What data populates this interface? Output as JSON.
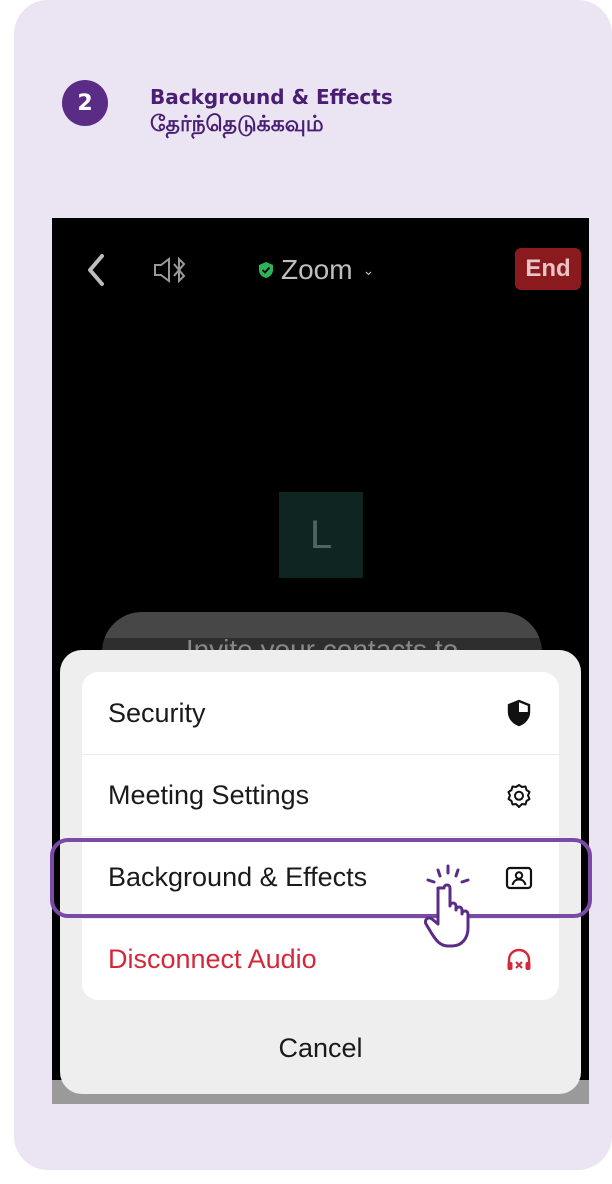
{
  "step": {
    "number": "2",
    "title": "Background & Effects",
    "subtitle": "தேர்ந்தெடுக்கவும்"
  },
  "zoom_ui": {
    "title": "Zoom",
    "end_label": "End",
    "avatar_initial": "L",
    "invite_text": "Invite your contacts to",
    "menu_items": [
      {
        "label": "Security",
        "icon": "shield-icon"
      },
      {
        "label": "Meeting Settings",
        "icon": "gear-icon"
      },
      {
        "label": "Background & Effects",
        "icon": "background-person-icon"
      },
      {
        "label": "Disconnect Audio",
        "icon": "headphones-x-icon"
      }
    ],
    "cancel_label": "Cancel"
  },
  "colors": {
    "card_background": "#ebe4f3",
    "accent_purple": "#5b2c86",
    "end_red": "#8b1a1f",
    "danger_red": "#d3283a"
  }
}
